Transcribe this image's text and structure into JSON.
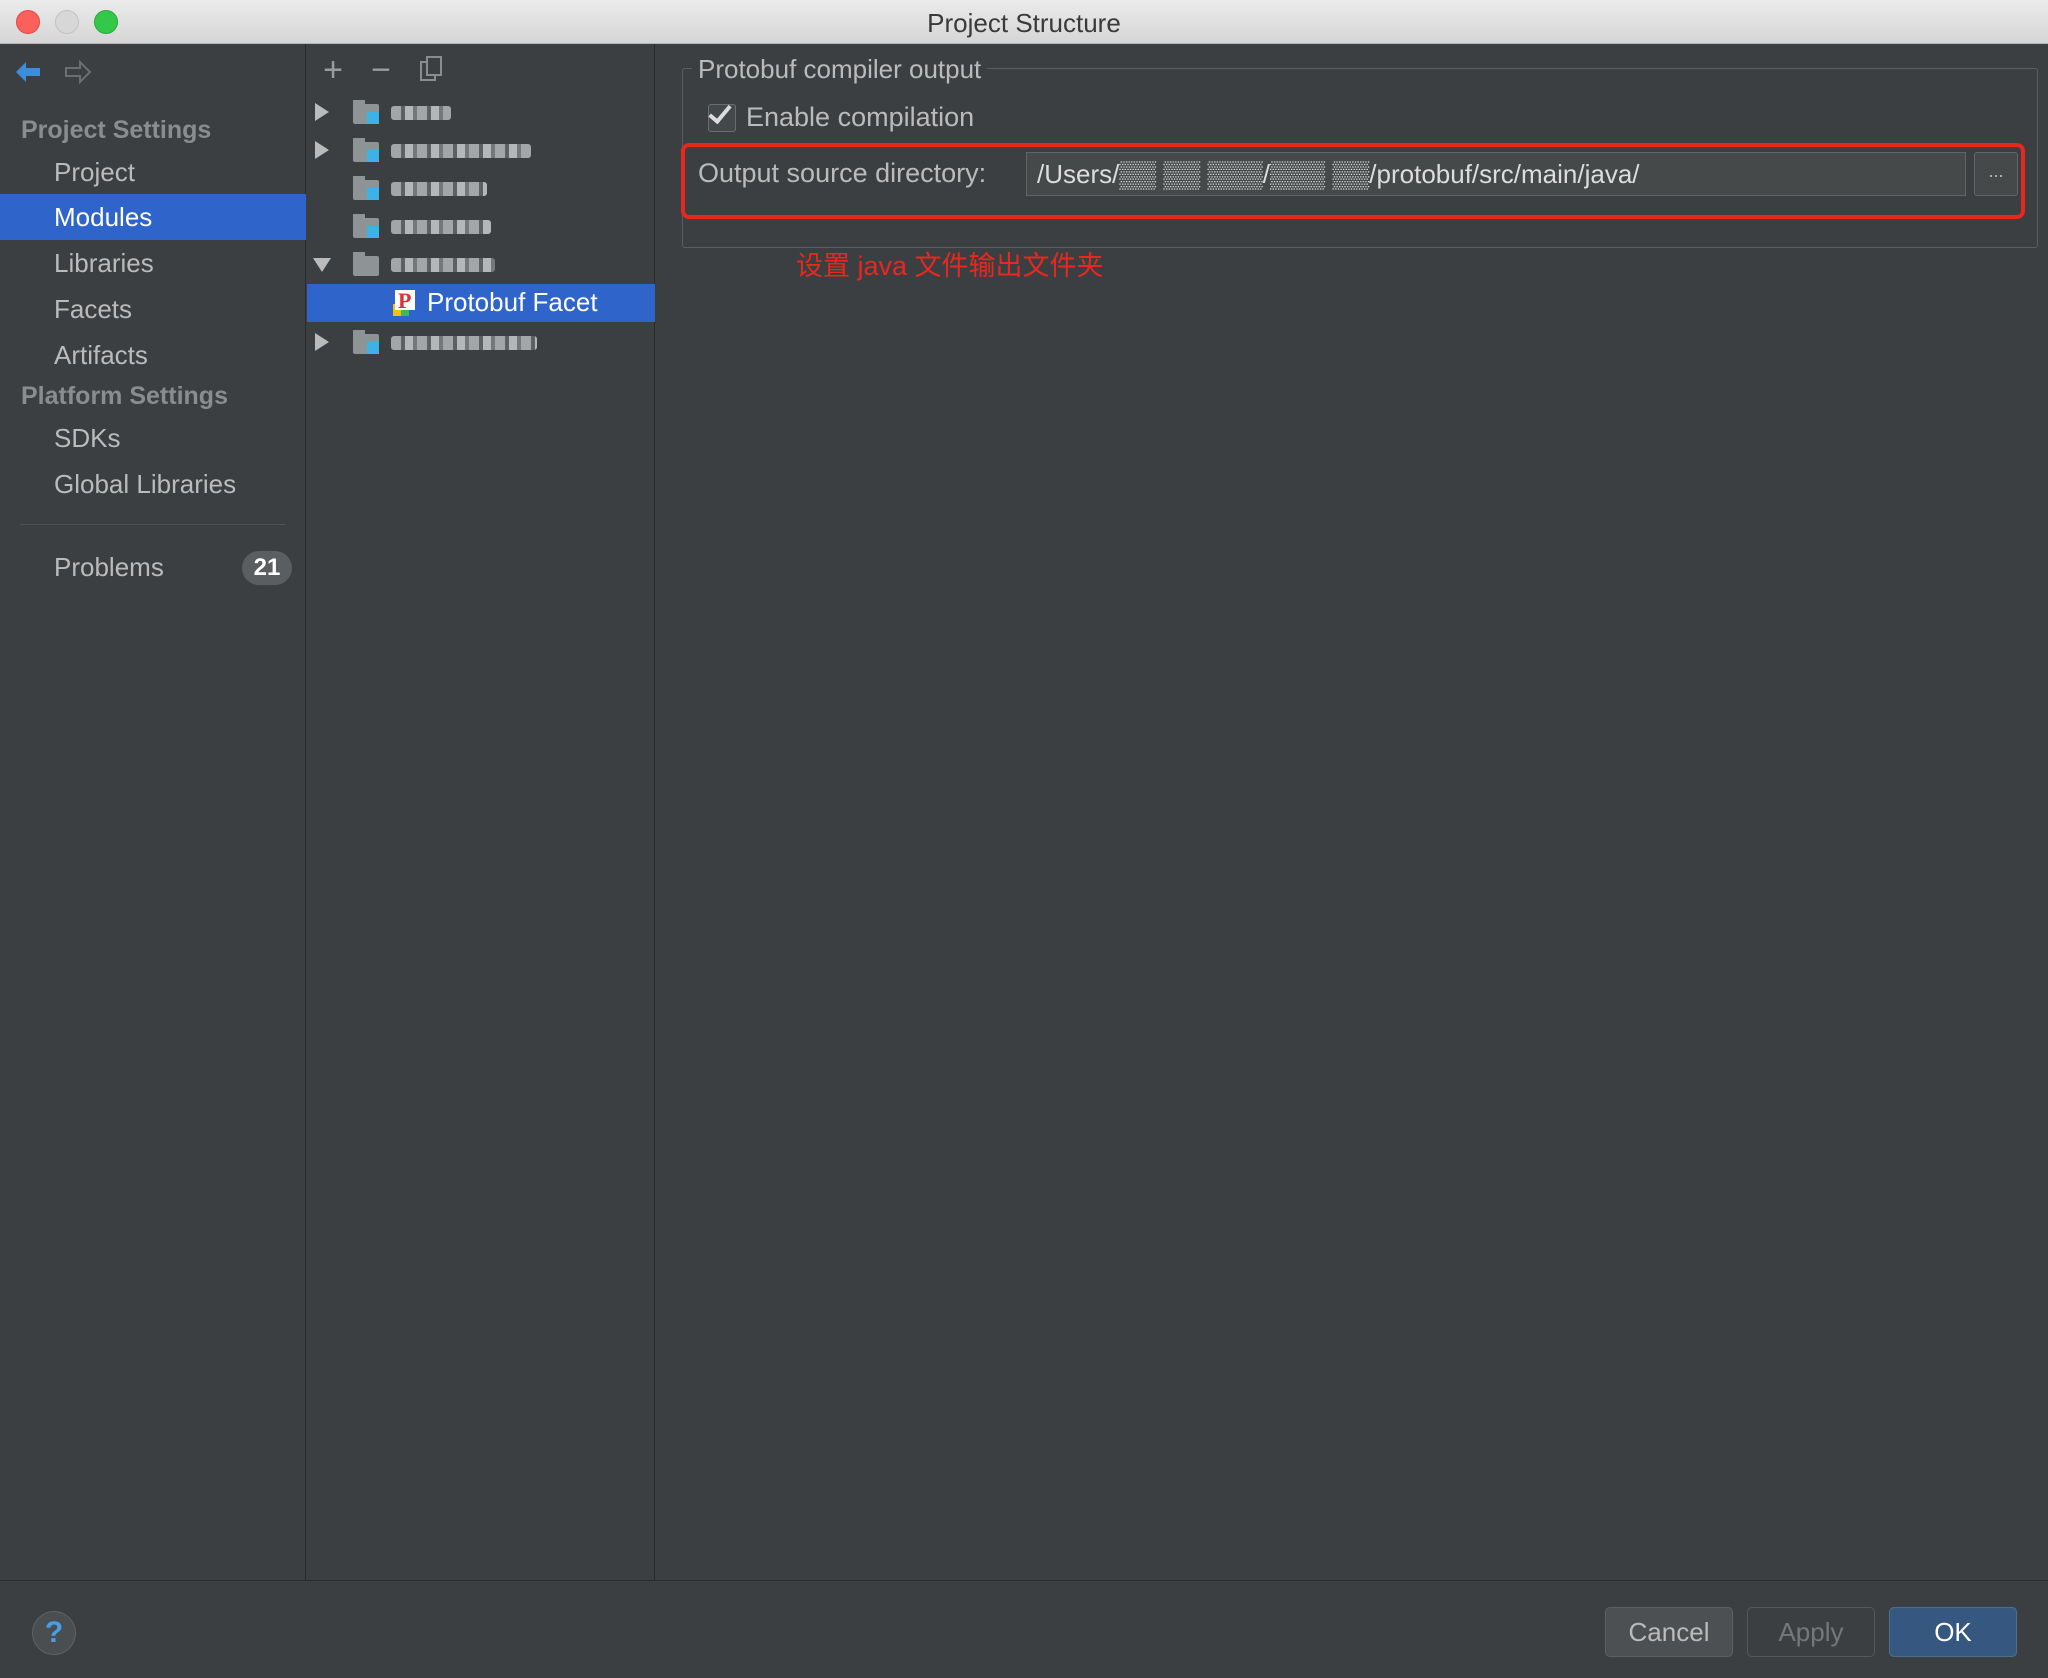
{
  "window": {
    "title": "Project Structure"
  },
  "left_nav": {
    "project_settings_header": "Project Settings",
    "project_items": [
      "Project",
      "Modules",
      "Libraries",
      "Facets",
      "Artifacts"
    ],
    "platform_settings_header": "Platform Settings",
    "platform_items": [
      "SDKs",
      "Global Libraries"
    ],
    "problems": {
      "label": "Problems",
      "count": "21"
    },
    "selected": "Modules"
  },
  "module_tree": {
    "toolbar": {
      "add": "+",
      "remove": "−"
    },
    "selected_facet": {
      "label": "Protobuf Facet",
      "icon": "protobuf-facet-icon"
    }
  },
  "main": {
    "group_title": "Protobuf compiler output",
    "enable_checkbox": {
      "label": "Enable compilation",
      "checked": true
    },
    "output_dir_label": "Output source directory:",
    "output_dir_value": "/Users/▒▒ ▒▒ ▒▒▒/▒▒▒ ▒▒/protobuf/src/main/java/",
    "browse_label": "...",
    "annotation": "设置 java 文件输出文件夹"
  },
  "footer": {
    "help_label": "?",
    "cancel_label": "Cancel",
    "apply_label": "Apply",
    "ok_label": "OK"
  },
  "colors": {
    "selection": "#2f65ca",
    "annotation_red": "#e8271f",
    "background": "#3c3f41"
  }
}
